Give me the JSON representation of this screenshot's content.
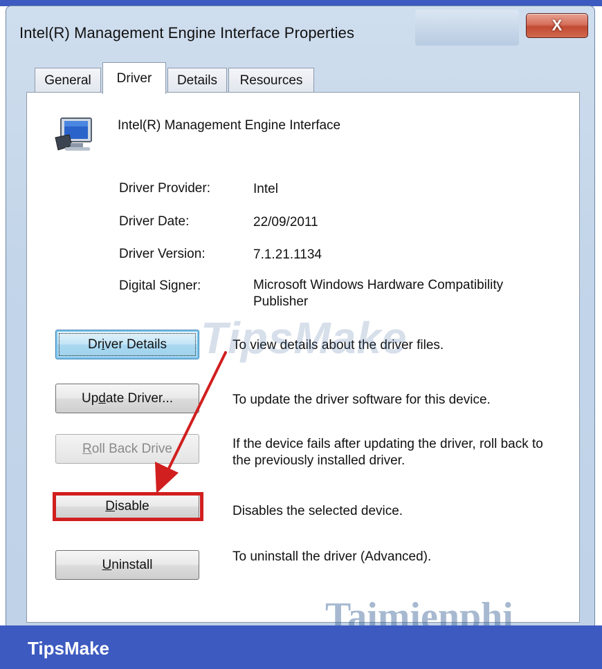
{
  "window": {
    "title": "Intel(R) Management Engine Interface  Properties",
    "close_glyph": "X"
  },
  "tabs": [
    {
      "label": "General"
    },
    {
      "label": "Driver"
    },
    {
      "label": "Details"
    },
    {
      "label": "Resources"
    }
  ],
  "active_tab": "Driver",
  "device": {
    "icon": "network-adapter-icon",
    "name": "Intel(R) Management Engine Interface"
  },
  "driver_info": [
    {
      "label": "Driver Provider:",
      "value": "Intel"
    },
    {
      "label": "Driver Date:",
      "value": "22/09/2011"
    },
    {
      "label": "Driver Version:",
      "value": "7.1.21.1134"
    },
    {
      "label": "Digital Signer:",
      "value": "Microsoft Windows Hardware Compatibility Publisher"
    }
  ],
  "actions": [
    {
      "pre": "Dr",
      "u": "i",
      "post": "ver Details",
      "desc": "To view details about the driver files."
    },
    {
      "pre": "Up",
      "u": "d",
      "post": "ate Driver...",
      "desc": "To update the driver software for this device."
    },
    {
      "pre": "",
      "u": "R",
      "post": "oll Back Drive",
      "desc": "If the device fails after updating the driver, roll back to the previously installed driver."
    },
    {
      "pre": "",
      "u": "D",
      "post": "isable",
      "desc": "Disables the selected device."
    },
    {
      "pre": "",
      "u": "U",
      "post": "ninstall",
      "desc": "To uninstall the driver (Advanced)."
    }
  ],
  "watermarks": {
    "middle": "TipsMake",
    "bottom": "Taimienphi"
  },
  "brand": "TipsMake",
  "colors": {
    "brand_bar": "#3d5ac0",
    "annotation_red": "#d11f1f"
  }
}
